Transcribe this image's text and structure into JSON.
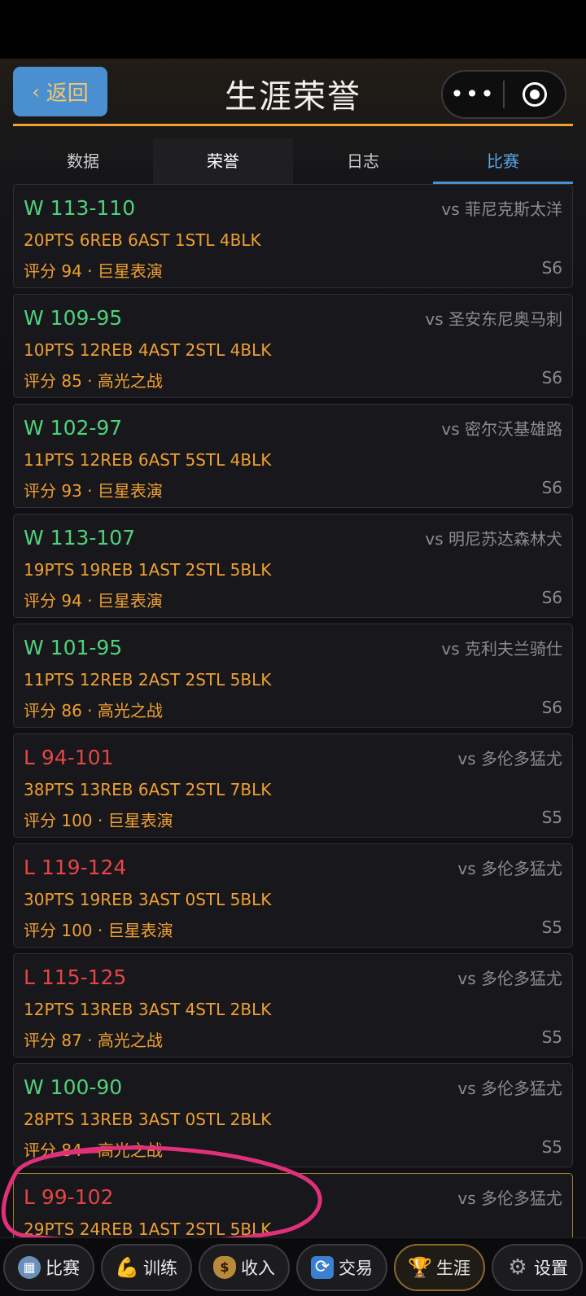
{
  "header": {
    "back_label": "返回",
    "title": "生涯荣誉",
    "more_icon": "more-dots-icon",
    "close_icon": "target-circle-icon"
  },
  "tabs": [
    {
      "label": "数据"
    },
    {
      "label": "荣誉"
    },
    {
      "label": "日志"
    },
    {
      "label": "比赛"
    }
  ],
  "active_tab": "比赛",
  "games": [
    {
      "result": "W",
      "score": "W 113-110",
      "opponent": "vs 菲尼克斯太洋",
      "stats": "20PTS 6REB 6AST 1STL 4BLK",
      "rating": "评分 94 · 巨星表演",
      "season": "S6"
    },
    {
      "result": "W",
      "score": "W 109-95",
      "opponent": "vs 圣安东尼奥马刺",
      "stats": "10PTS 12REB 4AST 2STL 4BLK",
      "rating": "评分 85 · 高光之战",
      "season": "S6"
    },
    {
      "result": "W",
      "score": "W 102-97",
      "opponent": "vs 密尔沃基雄路",
      "stats": "11PTS 12REB 6AST 5STL 4BLK",
      "rating": "评分 93 · 巨星表演",
      "season": "S6"
    },
    {
      "result": "W",
      "score": "W 113-107",
      "opponent": "vs 明尼苏达森林犬",
      "stats": "19PTS 19REB 1AST 2STL 5BLK",
      "rating": "评分 94 · 巨星表演",
      "season": "S6"
    },
    {
      "result": "W",
      "score": "W 101-95",
      "opponent": "vs 克利夫兰骑仕",
      "stats": "11PTS 12REB 2AST 2STL 5BLK",
      "rating": "评分 86 · 高光之战",
      "season": "S6"
    },
    {
      "result": "L",
      "score": "L 94-101",
      "opponent": "vs 多伦多猛尤",
      "stats": "38PTS 13REB 6AST 2STL 7BLK",
      "rating": "评分 100 · 巨星表演",
      "season": "S5"
    },
    {
      "result": "L",
      "score": "L 119-124",
      "opponent": "vs 多伦多猛尤",
      "stats": "30PTS 19REB 3AST 0STL 5BLK",
      "rating": "评分 100 · 巨星表演",
      "season": "S5"
    },
    {
      "result": "L",
      "score": "L 115-125",
      "opponent": "vs 多伦多猛尤",
      "stats": "12PTS 13REB 3AST 4STL 2BLK",
      "rating": "评分 87 · 高光之战",
      "season": "S5"
    },
    {
      "result": "W",
      "score": "W 100-90",
      "opponent": "vs 多伦多猛尤",
      "stats": "28PTS 13REB 3AST 0STL 2BLK",
      "rating": "评分 84 · 高光之战",
      "season": "S5"
    },
    {
      "result": "L",
      "score": "L 99-102",
      "opponent": "vs 多伦多猛尤",
      "stats": "29PTS 24REB 1AST 2STL 5BLK",
      "rating": "",
      "season": ""
    }
  ],
  "bottom_nav": [
    {
      "label": "比赛",
      "icon": "arena-icon"
    },
    {
      "label": "训练",
      "icon": "muscle-icon"
    },
    {
      "label": "收入",
      "icon": "money-bag-icon"
    },
    {
      "label": "交易",
      "icon": "swap-icon"
    },
    {
      "label": "生涯",
      "icon": "trophy-icon"
    },
    {
      "label": "设置",
      "icon": "gear-icon"
    }
  ],
  "colors": {
    "win": "#4fd27a",
    "loss": "#e64545",
    "accent": "#f0a030",
    "tab_active": "#5aa6e8",
    "annotation": "#e0307a"
  }
}
